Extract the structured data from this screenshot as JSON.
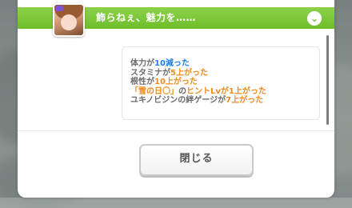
{
  "dialog": {
    "title": "飾らねぇ、魅力を……",
    "collapse_icon_glyph": "⌄",
    "close_button_label": "閉じる",
    "header_color": "#7cc93a"
  },
  "log": [
    {
      "parts": [
        {
          "t": "体力が",
          "c": "gray"
        },
        {
          "t": "10減った",
          "c": "blue"
        }
      ]
    },
    {
      "parts": [
        {
          "t": "スタミナが",
          "c": "gray"
        },
        {
          "t": "5上がった",
          "c": "orange"
        }
      ]
    },
    {
      "parts": [
        {
          "t": "根性が",
          "c": "gray"
        },
        {
          "t": "10上がった",
          "c": "orange"
        }
      ]
    },
    {
      "parts": [
        {
          "t": "「雪の日〇」",
          "c": "orange"
        },
        {
          "t": "の",
          "c": "gray"
        },
        {
          "t": "ヒントLvが1上がった",
          "c": "orange"
        }
      ]
    },
    {
      "parts": [
        {
          "t": "ユキノビジンの絆ゲージが",
          "c": "gray"
        },
        {
          "t": "7上がった",
          "c": "orange"
        }
      ]
    }
  ],
  "colors": {
    "gray": "#6a6a6a",
    "blue": "#1e7fe8",
    "orange": "#f08a1c"
  }
}
